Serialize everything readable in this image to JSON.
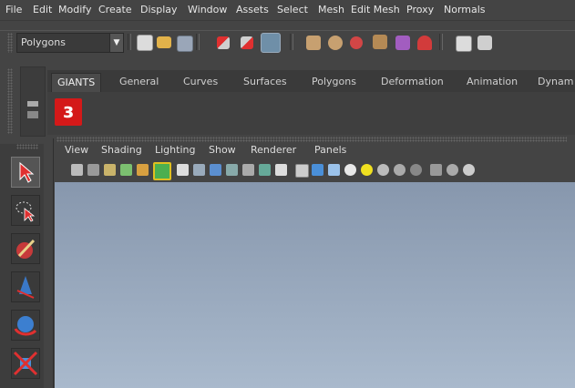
{
  "menubar": {
    "items": [
      "File",
      "Edit",
      "Modify",
      "Create",
      "Display",
      "Window",
      "Assets",
      "Select",
      "Mesh",
      "Edit Mesh",
      "Proxy",
      "Normals"
    ]
  },
  "statusline": {
    "mode_value": "Polygons",
    "dropdown_arrow": "▼",
    "icons": [
      "render-view-icon",
      "open-scene-icon",
      "save-scene-icon",
      "select-hierarchy-icon",
      "select-object-icon",
      "select-component-icon",
      "snap-grid-icon",
      "snap-curve-icon",
      "snap-point-icon",
      "snap-view-plane-icon",
      "make-live-icon",
      "magnet-icon",
      "render-icon"
    ]
  },
  "shelf": {
    "tabs": [
      "GIANTS",
      "General",
      "Curves",
      "Surfaces",
      "Polygons",
      "Deformation",
      "Animation",
      "Dynam"
    ],
    "active_tab": "GIANTS",
    "logo_glyph": "ɜ"
  },
  "toolbox": {
    "tools": [
      "select-tool-icon",
      "lasso-select-icon",
      "paint-select-icon",
      "move-tool-icon",
      "rotate-tool-icon",
      "scale-tool-icon"
    ]
  },
  "panel": {
    "menus": [
      "View",
      "Shading",
      "Lighting",
      "Show",
      "Renderer",
      "Panels"
    ]
  },
  "colors": {
    "background": "#444444",
    "viewport_top": "#8797ad",
    "viewport_bottom": "#a9b9cc",
    "logo_red": "#d41919",
    "select_red": "#e03030"
  }
}
